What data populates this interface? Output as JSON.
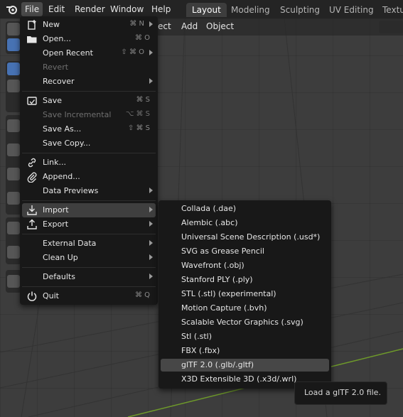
{
  "menubar": {
    "items": [
      "File",
      "Edit",
      "Render",
      "Window",
      "Help"
    ]
  },
  "workspaces": {
    "tabs": [
      "Layout",
      "Modeling",
      "Sculpting",
      "UV Editing",
      "Texture"
    ]
  },
  "viewport_header": {
    "items": [
      "ect",
      "Add",
      "Object"
    ]
  },
  "file_menu": {
    "items": [
      {
        "label": "New",
        "shortcut": "⌘ N"
      },
      {
        "label": "Open...",
        "shortcut": "⌘ O"
      },
      {
        "label": "Open Recent",
        "shortcut": "⇧ ⌘ O"
      },
      {
        "label": "Revert",
        "shortcut": ""
      },
      {
        "label": "Recover",
        "shortcut": ""
      },
      {
        "label": "Save",
        "shortcut": "⌘ S"
      },
      {
        "label": "Save Incremental",
        "shortcut": "⌥ ⌘ S"
      },
      {
        "label": "Save As...",
        "shortcut": "⇧ ⌘ S"
      },
      {
        "label": "Save Copy...",
        "shortcut": ""
      },
      {
        "label": "Link...",
        "shortcut": ""
      },
      {
        "label": "Append...",
        "shortcut": ""
      },
      {
        "label": "Data Previews",
        "shortcut": ""
      },
      {
        "label": "Import",
        "shortcut": ""
      },
      {
        "label": "Export",
        "shortcut": ""
      },
      {
        "label": "External Data",
        "shortcut": ""
      },
      {
        "label": "Clean Up",
        "shortcut": ""
      },
      {
        "label": "Defaults",
        "shortcut": ""
      },
      {
        "label": "Quit",
        "shortcut": "⌘ Q"
      }
    ]
  },
  "import_menu": {
    "items": [
      "Collada (.dae)",
      "Alembic (.abc)",
      "Universal Scene Description (.usd*)",
      "SVG as Grease Pencil",
      "Wavefront (.obj)",
      "Stanford PLY (.ply)",
      "STL (.stl) (experimental)",
      "Motion Capture (.bvh)",
      "Scalable Vector Graphics (.svg)",
      "Stl (.stl)",
      "FBX (.fbx)",
      "glTF 2.0 (.glb/.gltf)",
      "X3D Extensible 3D (.x3d/.wrl)"
    ]
  },
  "tooltip": {
    "text": "Load a glTF 2.0 file."
  },
  "colors": {
    "menu_bg": "#181818",
    "highlight": "#474747",
    "accent_blue": "#4772b3",
    "grid_x_axis": "#9a3a3a",
    "grid_y_axis": "#6e9a2a"
  }
}
